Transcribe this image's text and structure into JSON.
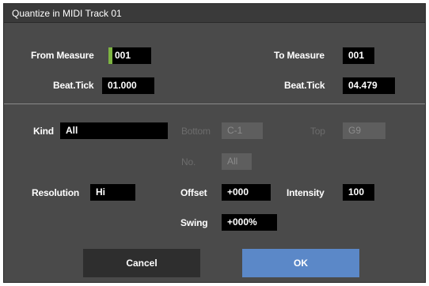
{
  "dialog": {
    "title": "Quantize in MIDI Track 01"
  },
  "range": {
    "from_measure_label": "From Measure",
    "from_measure_value": "001",
    "from_beat_label": "Beat.Tick",
    "from_beat_value": "01.000",
    "to_measure_label": "To Measure",
    "to_measure_value": "001",
    "to_beat_label": "Beat.Tick",
    "to_beat_value": "04.479"
  },
  "params": {
    "kind_label": "Kind",
    "kind_value": "All",
    "bottom_label": "Bottom",
    "bottom_value": "C-1",
    "top_label": "Top",
    "top_value": "G9",
    "no_label": "No.",
    "no_value": "All",
    "resolution_label": "Resolution",
    "resolution_value": "Hi",
    "offset_label": "Offset",
    "offset_value": "+000",
    "intensity_label": "Intensity",
    "intensity_value": "100",
    "swing_label": "Swing",
    "swing_value": "+000%"
  },
  "buttons": {
    "cancel_label": "Cancel",
    "ok_label": "OK"
  },
  "colors": {
    "dialog_bg": "#4a4a4a",
    "field_bg": "#000000",
    "cursor_accent": "#7db441",
    "ok_button": "#5b88c8",
    "cancel_button": "#2e2e2e"
  }
}
